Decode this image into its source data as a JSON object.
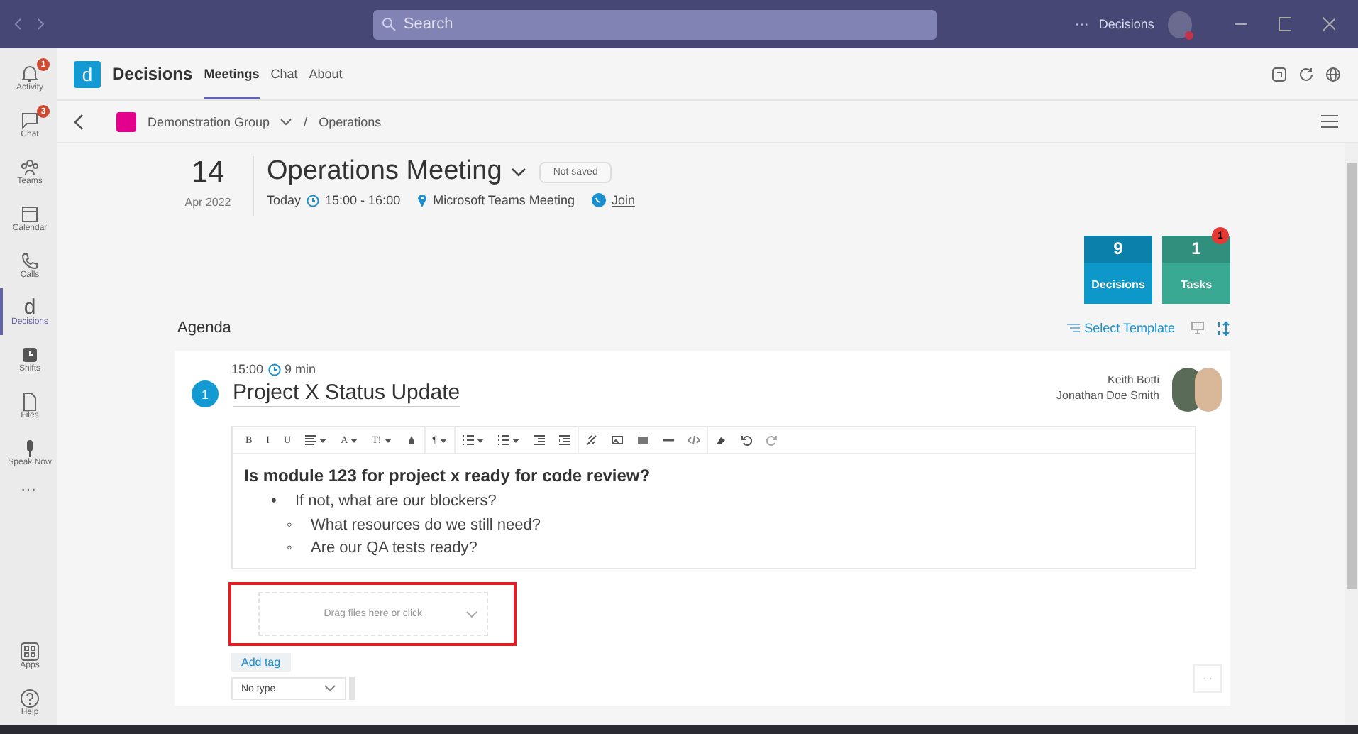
{
  "titlebar": {
    "search": {
      "placeholder": "Search"
    },
    "more": "···",
    "user": "Decisions"
  },
  "rail": [
    {
      "label": "Activity",
      "kind": "bell",
      "badge": "1",
      "selected": false
    },
    {
      "label": "Chat",
      "kind": "chat",
      "badge": "3",
      "selected": false
    },
    {
      "label": "Teams",
      "kind": "teams",
      "selected": false
    },
    {
      "label": "Calendar",
      "kind": "calendar",
      "selected": false
    },
    {
      "label": "Calls",
      "kind": "phone",
      "selected": false
    },
    {
      "label": "Decisions",
      "kind": "letter",
      "glyph": "d",
      "selected": true
    },
    {
      "label": "Shifts",
      "kind": "clock",
      "selected": false
    },
    {
      "label": "Files",
      "kind": "file",
      "selected": false
    },
    {
      "label": "Speak Now",
      "kind": "mic",
      "selected": false
    }
  ],
  "rail_more": "···",
  "rail_bottom": [
    {
      "label": "Apps",
      "kind": "apps",
      "selected": false
    },
    {
      "label": "Help",
      "kind": "help",
      "selected": false
    }
  ],
  "app": {
    "logo": "d",
    "name": "Decisions",
    "tabs": [
      {
        "label": "Meetings",
        "selected": true
      },
      {
        "label": "Chat",
        "selected": false
      },
      {
        "label": "About",
        "selected": false
      }
    ]
  },
  "breadcrumb": {
    "group": "Demonstration Group",
    "separator": "/",
    "current": "Operations"
  },
  "meeting": {
    "day": "14",
    "month": "Apr 2022",
    "title": "Operations Meeting",
    "status": "Not saved",
    "when": "Today",
    "time": "15:00 - 16:00",
    "location": "Microsoft Teams Meeting",
    "join": "Join"
  },
  "counters": [
    {
      "value": "9",
      "label": "Decisions",
      "color": "#0e97c9"
    },
    {
      "value": "1",
      "label": "Tasks",
      "color": "#3aa993",
      "badge": "1"
    }
  ],
  "agenda": {
    "heading": "Agenda",
    "select_template": "Select Template",
    "items": [
      {
        "number": "1",
        "start": "15:00",
        "duration": "9 min",
        "title": "Project X Status Update",
        "presenters": [
          "Keith Botti",
          "Jonathan Doe Smith"
        ],
        "toolbar": [
          {
            "kind": "text",
            "label": "B"
          },
          {
            "kind": "text",
            "label": "I"
          },
          {
            "kind": "text",
            "label": "U"
          },
          {
            "kind": "align"
          },
          {
            "kind": "menu",
            "label": "A"
          },
          {
            "kind": "menu",
            "label": "T!"
          },
          {
            "kind": "drop"
          },
          {
            "kind": "sep"
          },
          {
            "kind": "menu",
            "label": "¶"
          },
          {
            "kind": "sep"
          },
          {
            "kind": "ol"
          },
          {
            "kind": "ul"
          },
          {
            "kind": "outdent"
          },
          {
            "kind": "indent"
          },
          {
            "kind": "sep"
          },
          {
            "kind": "link"
          },
          {
            "kind": "image"
          },
          {
            "kind": "table"
          },
          {
            "kind": "hr"
          },
          {
            "kind": "code"
          },
          {
            "kind": "sep"
          },
          {
            "kind": "eraser"
          },
          {
            "kind": "undo"
          },
          {
            "kind": "redo"
          }
        ],
        "content": {
          "heading": "Is module 123 for project x ready for code review?",
          "bullets": [
            {
              "marker": "•",
              "text": "If not, what are our blockers?",
              "children": [
                {
                  "marker": "◦",
                  "text": "What resources do we still need?"
                },
                {
                  "marker": "◦",
                  "text": "Are our QA tests ready?"
                }
              ]
            }
          ]
        },
        "attachments": {
          "placeholder": "Drag files here or click",
          "highlighted": true
        },
        "add_tag": "Add tag",
        "type": "No type",
        "more": "···"
      }
    ]
  }
}
